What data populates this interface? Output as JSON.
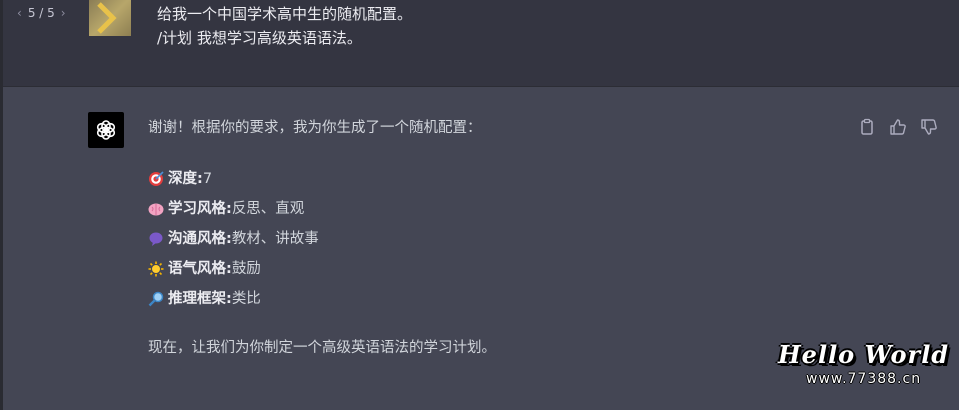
{
  "pager": {
    "prev": "‹",
    "text": "5 / 5",
    "next": "›"
  },
  "user": {
    "lines": [
      "给我一个中国学术高中生的随机配置。",
      "/计划 我想学习高级英语语法。"
    ]
  },
  "assistant": {
    "intro": "谢谢！根据你的要求，我为你生成了一个随机配置：",
    "items": [
      {
        "icon": "target-icon",
        "key": "深度:",
        "value": " 7"
      },
      {
        "icon": "brain-icon",
        "key": "学习风格:",
        "value": " 反思、直观"
      },
      {
        "icon": "speech-bubble-icon",
        "key": "沟通风格:",
        "value": " 教材、讲故事"
      },
      {
        "icon": "sun-icon",
        "key": "语气风格:",
        "value": " 鼓励"
      },
      {
        "icon": "magnifier-icon",
        "key": "推理框架:",
        "value": " 类比"
      }
    ],
    "outro": "现在，让我们为你制定一个高级英语语法的学习计划。"
  },
  "actions": [
    "copy-icon",
    "thumbs-up-icon",
    "thumbs-down-icon"
  ],
  "watermark": {
    "title": "Hello World",
    "url": "www.77388.cn"
  },
  "colors": {
    "user_bg": "#343541",
    "assistant_bg": "#444654",
    "text": "#ececf1"
  }
}
